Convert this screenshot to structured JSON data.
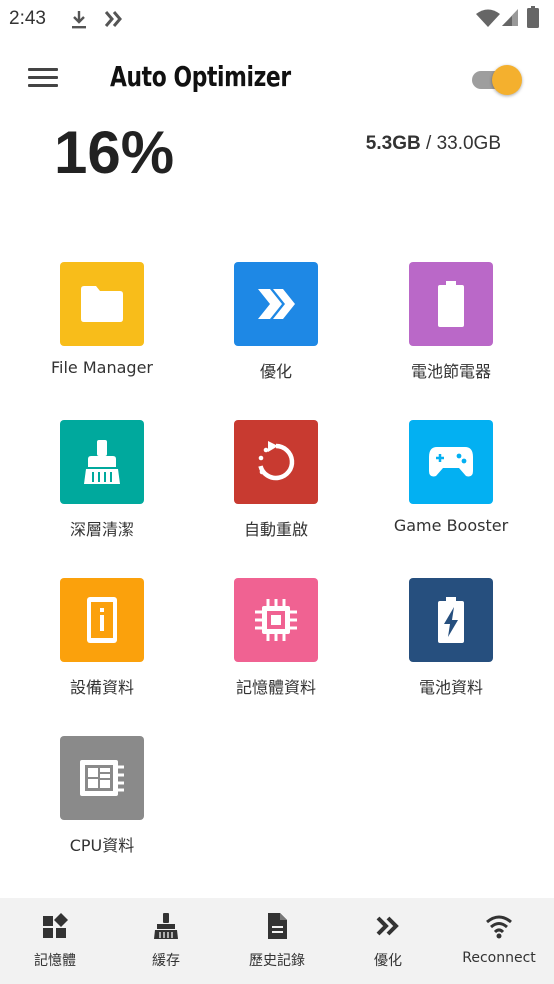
{
  "status_bar": {
    "time": "2:43"
  },
  "header": {
    "title": "Auto Optimizer",
    "toggle_on": true,
    "toggle_color": "#f4b02e"
  },
  "memory": {
    "percent": "16%",
    "used": "5.3GB",
    "separator": " / ",
    "total": "33.0GB"
  },
  "tiles": [
    {
      "label": "File Manager",
      "icon": "folder-icon",
      "color": "#f8bd1a"
    },
    {
      "label": "優化",
      "icon": "optimize-chevrons-icon",
      "color": "#1e88e5"
    },
    {
      "label": "電池節電器",
      "icon": "battery-icon",
      "color": "#ba68c8"
    },
    {
      "label": "深層清潔",
      "icon": "broom-icon",
      "color": "#00a99d"
    },
    {
      "label": "自動重啟",
      "icon": "restart-icon",
      "color": "#c83a30"
    },
    {
      "label": "Game Booster",
      "icon": "gamepad-icon",
      "color": "#03b0f2"
    },
    {
      "label": "設備資料",
      "icon": "device-info-icon",
      "color": "#fba10c"
    },
    {
      "label": "記憶體資料",
      "icon": "chip-icon",
      "color": "#f06292"
    },
    {
      "label": "電池資料",
      "icon": "battery-charging-icon",
      "color": "#264f7e"
    },
    {
      "label": "CPU資料",
      "icon": "cpu-icon",
      "color": "#8a8a8a"
    }
  ],
  "bottom_nav": [
    {
      "label": "記憶體",
      "icon": "dashboard-icon"
    },
    {
      "label": "緩存",
      "icon": "broom-icon"
    },
    {
      "label": "歷史記錄",
      "icon": "document-icon"
    },
    {
      "label": "優化",
      "icon": "chevrons-icon"
    },
    {
      "label": "Reconnect",
      "icon": "wifi-icon"
    }
  ]
}
